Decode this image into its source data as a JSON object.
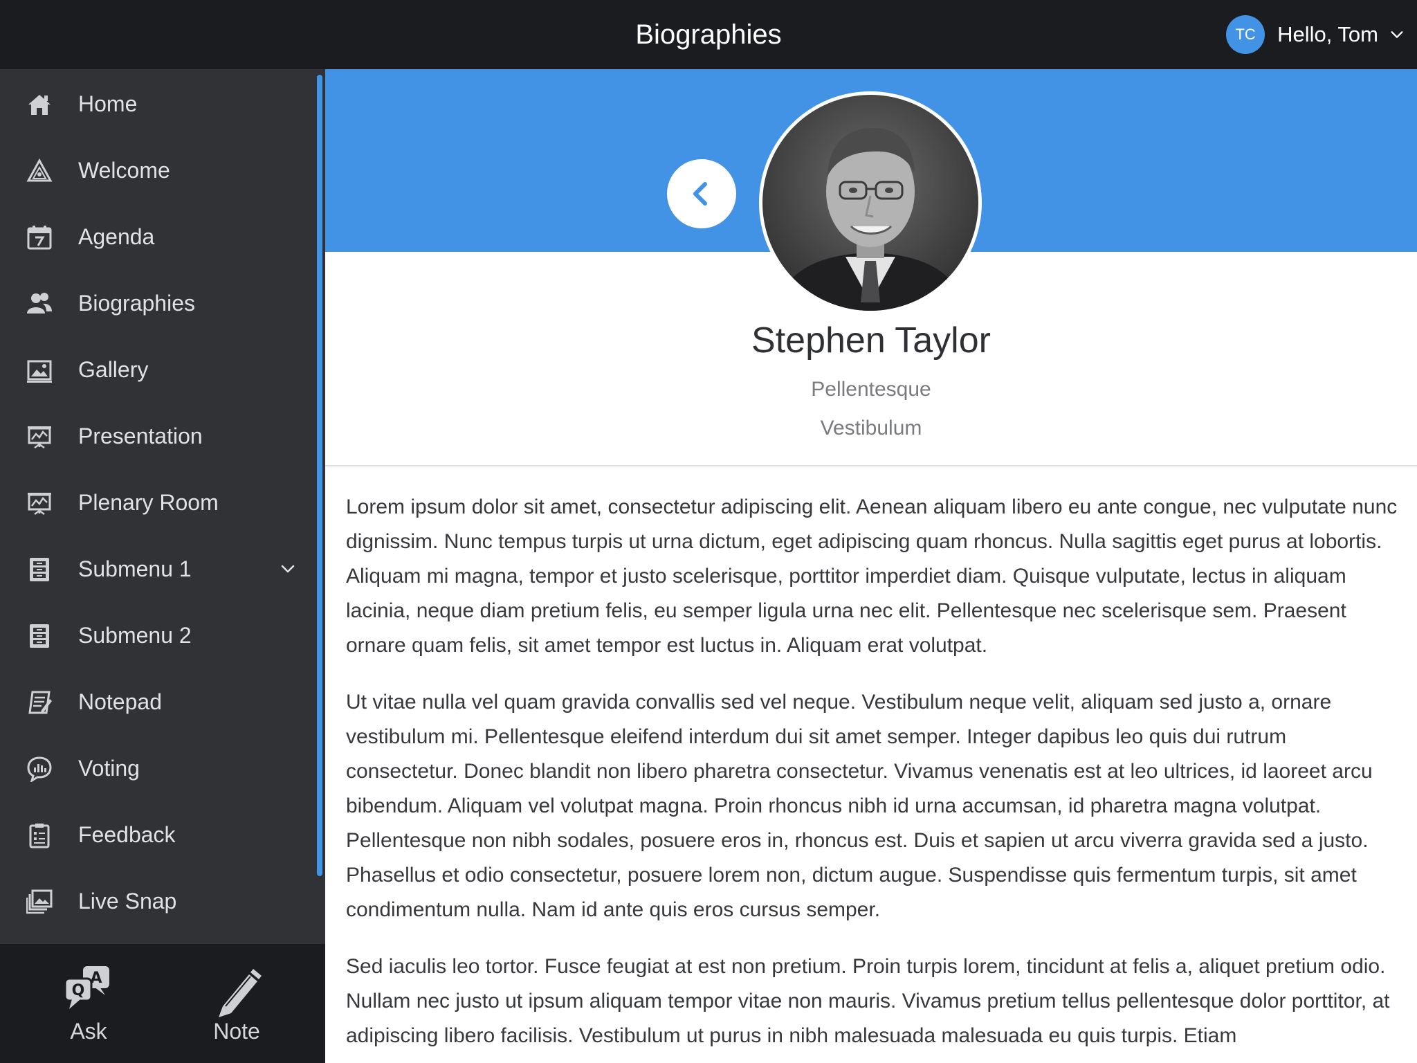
{
  "header": {
    "title": "Biographies",
    "user_initials": "TC",
    "greeting": "Hello, Tom"
  },
  "sidebar": {
    "items": [
      {
        "label": "Home",
        "icon": "home-icon"
      },
      {
        "label": "Welcome",
        "icon": "welcome-icon"
      },
      {
        "label": "Agenda",
        "icon": "calendar-icon"
      },
      {
        "label": "Biographies",
        "icon": "people-icon"
      },
      {
        "label": "Gallery",
        "icon": "image-icon"
      },
      {
        "label": "Presentation",
        "icon": "presentation-icon"
      },
      {
        "label": "Plenary Room",
        "icon": "presentation-icon"
      },
      {
        "label": "Submenu 1",
        "icon": "cabinet-icon",
        "expandable": true
      },
      {
        "label": "Submenu 2",
        "icon": "cabinet-icon"
      },
      {
        "label": "Notepad",
        "icon": "notepad-icon"
      },
      {
        "label": "Voting",
        "icon": "voting-icon"
      },
      {
        "label": "Feedback",
        "icon": "clipboard-icon"
      },
      {
        "label": "Live Snap",
        "icon": "photos-icon"
      }
    ],
    "bottom": {
      "ask_label": "Ask",
      "note_label": "Note"
    }
  },
  "profile": {
    "name": "Stephen Taylor",
    "line1": "Pellentesque",
    "line2": "Vestibulum"
  },
  "bio": {
    "paragraphs": [
      "Lorem ipsum dolor sit amet, consectetur adipiscing elit. Aenean aliquam libero eu ante congue, nec vulputate nunc dignissim. Nunc tempus turpis ut urna dictum, eget adipiscing quam rhoncus. Nulla sagittis eget purus at lobortis. Aliquam mi magna, tempor et justo scelerisque, porttitor imperdiet diam. Quisque vulputate, lectus in aliquam lacinia, neque diam pretium felis, eu semper ligula urna nec elit. Pellentesque nec scelerisque sem. Praesent ornare quam felis, sit amet tempor est luctus in. Aliquam erat volutpat.",
      "Ut vitae nulla vel quam gravida convallis sed vel neque. Vestibulum neque velit, aliquam sed justo a, ornare vestibulum mi. Pellentesque eleifend interdum dui sit amet semper. Integer dapibus leo quis dui rutrum consectetur. Donec blandit non libero pharetra consectetur. Vivamus venenatis est at leo ultrices, id laoreet arcu bibendum. Aliquam vel volutpat magna. Proin rhoncus nibh id urna accumsan, id pharetra magna volutpat. Pellentesque non nibh sodales, posuere eros in, rhoncus est. Duis et sapien ut arcu viverra gravida sed a justo. Phasellus et odio consectetur, posuere lorem non, dictum augue. Suspendisse quis fermentum turpis, sit amet condimentum nulla. Nam id ante quis eros cursus semper.",
      "Sed iaculis leo tortor. Fusce feugiat at est non pretium. Proin turpis lorem, tincidunt at felis a, aliquet pretium odio. Nullam nec justo ut ipsum aliquam tempor vitae non mauris. Vivamus pretium tellus pellentesque dolor porttitor, at adipiscing libero facilisis. Vestibulum ut purus in nibh malesuada malesuada eu quis turpis. Etiam"
    ]
  },
  "colors": {
    "accent": "#4293e6",
    "topbar": "#1b1c20",
    "sidebar": "#303236"
  }
}
